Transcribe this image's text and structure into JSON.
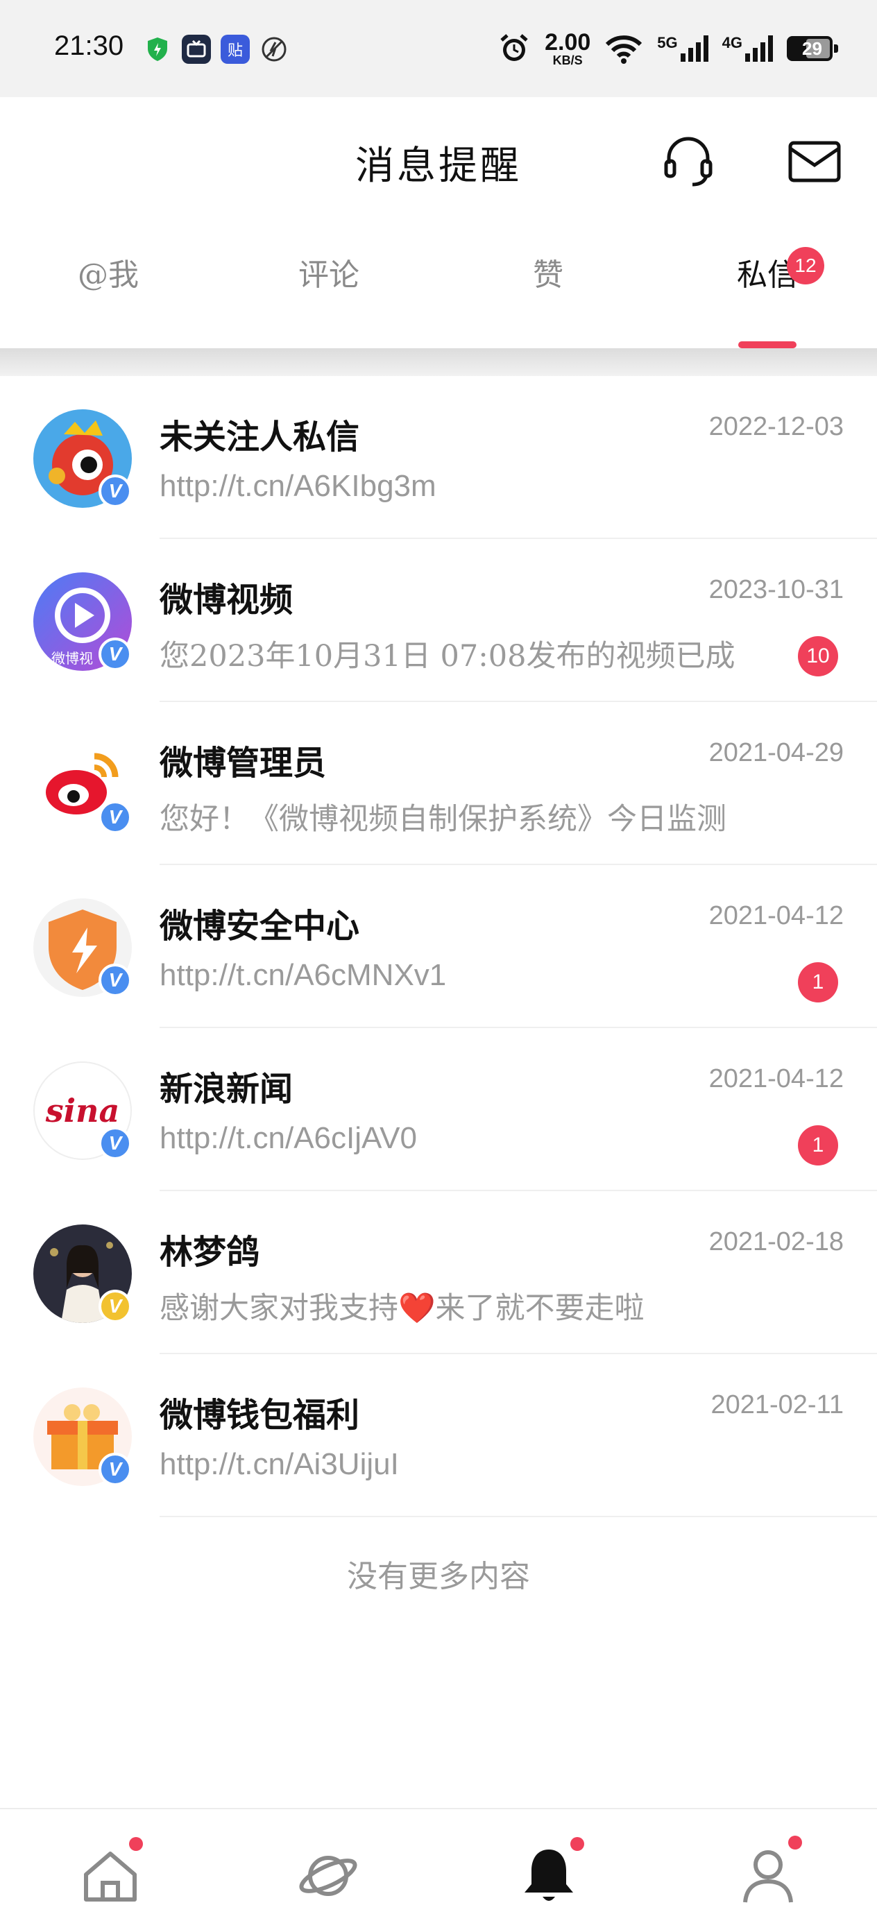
{
  "status_bar": {
    "time": "21:30",
    "app_icons": [
      "shield-icon",
      "app-icon",
      "tieba-icon",
      "no-data-icon"
    ],
    "app_icon_labels": {
      "tieba": "贴"
    },
    "net_speed_value": "2.00",
    "net_speed_unit": "KB/S",
    "net1": "5G",
    "net2": "4G",
    "battery": "29"
  },
  "header": {
    "title": "消息提醒",
    "service_icon": "headset-icon",
    "mail_icon": "envelope-icon"
  },
  "tabs": [
    {
      "label": "@我"
    },
    {
      "label": "评论"
    },
    {
      "label": "赞"
    },
    {
      "label": "私信",
      "badge": "12",
      "active": true
    }
  ],
  "messages": [
    {
      "name": "未关注人私信",
      "date": "2022-12-03",
      "preview": "http://t.cn/A6KIbg3m",
      "badge": "",
      "verify": "V"
    },
    {
      "name": "微博视频",
      "date": "2023-10-31",
      "preview": "您2023年10月31日 07:08发布的视频已成",
      "badge": "10",
      "verify": "V",
      "avatar_text": "微博视"
    },
    {
      "name": "微博管理员",
      "date": "2021-04-29",
      "preview": "您好！《微博视频自制保护系统》今日监测",
      "badge": "",
      "verify": "V"
    },
    {
      "name": "微博安全中心",
      "date": "2021-04-12",
      "preview": "http://t.cn/A6cMNXv1",
      "badge": "1",
      "verify": "V"
    },
    {
      "name": "新浪新闻",
      "date": "2021-04-12",
      "preview": "http://t.cn/A6cIjAV0",
      "badge": "1",
      "verify": "V",
      "avatar_text": "sina"
    },
    {
      "name": "林梦鸽",
      "date": "2021-02-18",
      "preview": "感谢大家对我支持❤️来了就不要走啦",
      "badge": "",
      "verify": "V"
    },
    {
      "name": "微博钱包福利",
      "date": "2021-02-11",
      "preview": "http://t.cn/Ai3UijuI",
      "badge": "",
      "verify": "V"
    }
  ],
  "footer_text": "没有更多内容",
  "bottom_nav": [
    "home-icon",
    "discover-planet-icon",
    "notification-bell-icon",
    "profile-icon"
  ],
  "colors": {
    "accent": "#f0405a",
    "verified_blue": "#4a8ef0",
    "verified_gold": "#f2c230"
  }
}
